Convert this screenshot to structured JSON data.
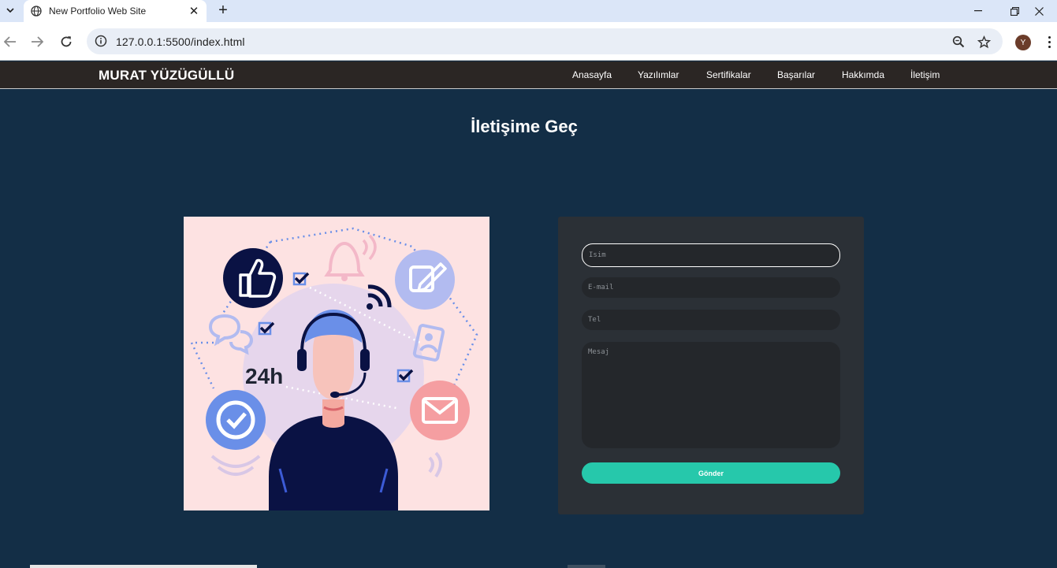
{
  "browser": {
    "tab_title": "New Portfolio Web Site",
    "new_tab_symbol": "+",
    "close_symbol": "✕",
    "url": "127.0.0.1:5500/index.html",
    "profile_initial": "Y",
    "window_controls": {
      "minimize": "—",
      "restore": "❐",
      "close": "✕"
    }
  },
  "site": {
    "brand": "MURAT YÜZÜGÜLLÜ",
    "nav": [
      "Anasayfa",
      "Yazılımlar",
      "Sertifikalar",
      "Başarılar",
      "Hakkımda",
      "İletişim"
    ]
  },
  "contact": {
    "title": "İletişime Geç",
    "illustration": {
      "label_24h": "24h",
      "icons": [
        "thumbs-up-icon",
        "bell-icon",
        "edit-icon",
        "chat-bubbles-icon",
        "rss-icon",
        "contact-card-icon",
        "check-circle-icon",
        "mail-icon",
        "checkbox-icon",
        "support-agent"
      ]
    },
    "form": {
      "name_placeholder": "İsim",
      "email_placeholder": "E-mail",
      "phone_placeholder": "Tel",
      "message_placeholder": "Mesaj",
      "submit_label": "Gönder"
    }
  },
  "colors": {
    "page_bg": "#132e46",
    "header_bg": "#2b2624",
    "card_bg": "#2b3036",
    "field_bg": "#24272b",
    "accent": "#26c8ab",
    "illustration_bg": "#fde2e2"
  }
}
